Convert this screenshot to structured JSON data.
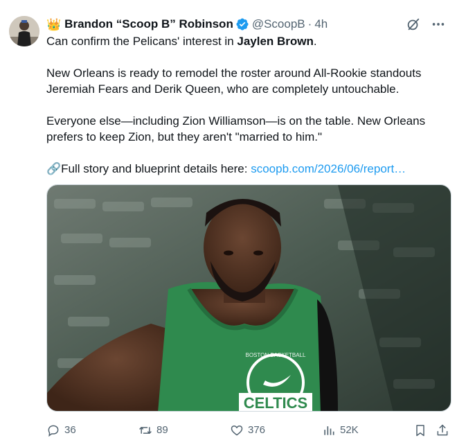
{
  "author": {
    "badge_emoji": "👑",
    "display_name": "Brandon “Scoop B” Robinson",
    "handle": "@ScoopB",
    "separator": "·",
    "time": "4h"
  },
  "tweet": {
    "line1_prefix": "Can confirm the Pelicans' interest in ",
    "line1_bold": "Jaylen Brown",
    "line1_suffix": ".",
    "para2": "New Orleans is ready to remodel the roster around All-Rookie standouts Jeremiah Fears and Derik Queen, who are completely untouchable.",
    "para3": "Everyone else—including Zion Williamson—is on the table. New Orleans prefers to keep Zion, but they aren't \"married to him.\"",
    "link_prefix": "🔗Full story and blueprint details here: ",
    "link_text": "scoopb.com/2026/06/report…"
  },
  "media": {
    "jersey_text": "CELTICS",
    "jersey_small_text": "BOSTON BASKETBALL"
  },
  "engagement": {
    "replies": "36",
    "reposts": "89",
    "likes": "376",
    "views": "52K"
  },
  "icons": {
    "verified": "verified-badge-icon",
    "grok": "grok-icon",
    "more": "more-icon",
    "reply": "reply-icon",
    "repost": "repost-icon",
    "like": "heart-icon",
    "views": "views-icon",
    "bookmark": "bookmark-icon",
    "share": "share-icon"
  },
  "colors": {
    "accent": "#1d9bf0",
    "secondary_text": "#536471",
    "text": "#0f1419"
  }
}
